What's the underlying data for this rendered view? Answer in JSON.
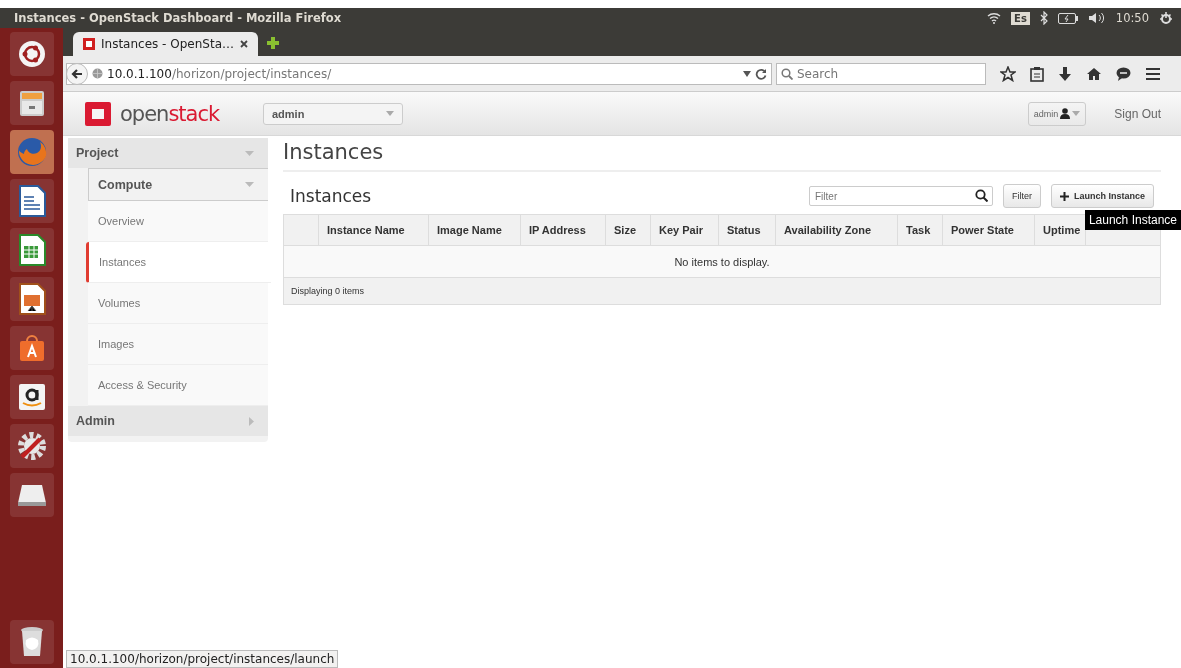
{
  "window": {
    "title": "Instances - OpenStack Dashboard - Mozilla Firefox"
  },
  "system_tray": {
    "keyboard": "Es",
    "time": "10:50"
  },
  "launcher": [
    {
      "kind": "ubuntu",
      "active": false
    },
    {
      "kind": "files",
      "active": false
    },
    {
      "kind": "firefox",
      "active": true
    },
    {
      "kind": "writer",
      "active": false
    },
    {
      "kind": "calc",
      "active": false
    },
    {
      "kind": "impress",
      "active": false
    },
    {
      "kind": "store",
      "active": false
    },
    {
      "kind": "amazon",
      "active": false
    },
    {
      "kind": "settings",
      "active": false
    },
    {
      "kind": "drive",
      "active": false
    },
    {
      "kind": "trash",
      "active": false
    }
  ],
  "browser": {
    "tabs": [
      {
        "label": "Instances - OpenSta…",
        "selected": true
      }
    ],
    "url_host": "10.0.1.100",
    "url_path": "/horizon/project/instances/",
    "search": {
      "placeholder": "Search"
    },
    "status_link": "10.0.1.100/horizon/project/instances/launch"
  },
  "header": {
    "logo_open": "open",
    "logo_stack": "stack",
    "project": "admin",
    "user": "admin",
    "sign_out": "Sign Out"
  },
  "sidebar": [
    {
      "label": "Project",
      "expanded": true,
      "children": [
        {
          "label": "Compute",
          "expanded": true,
          "children": [
            {
              "label": "Overview",
              "selected": false
            },
            {
              "label": "Instances",
              "selected": true
            },
            {
              "label": "Volumes",
              "selected": false
            },
            {
              "label": "Images",
              "selected": false
            },
            {
              "label": "Access & Security",
              "selected": false
            }
          ]
        }
      ]
    },
    {
      "label": "Admin",
      "expanded": false
    }
  ],
  "page_title": "Instances",
  "table": {
    "title": "Instances",
    "filter": {
      "placeholder": "Filter"
    },
    "filter_button": "Filter",
    "launch_button": "Launch Instance",
    "tooltip": "Launch Instance",
    "columns": [
      "Instance Name",
      "Image Name",
      "IP Address",
      "Size",
      "Key Pair",
      "Status",
      "Availability Zone",
      "Task",
      "Power State",
      "Uptime"
    ],
    "empty_message": "No items to display.",
    "footer": "Displaying 0 items"
  }
}
